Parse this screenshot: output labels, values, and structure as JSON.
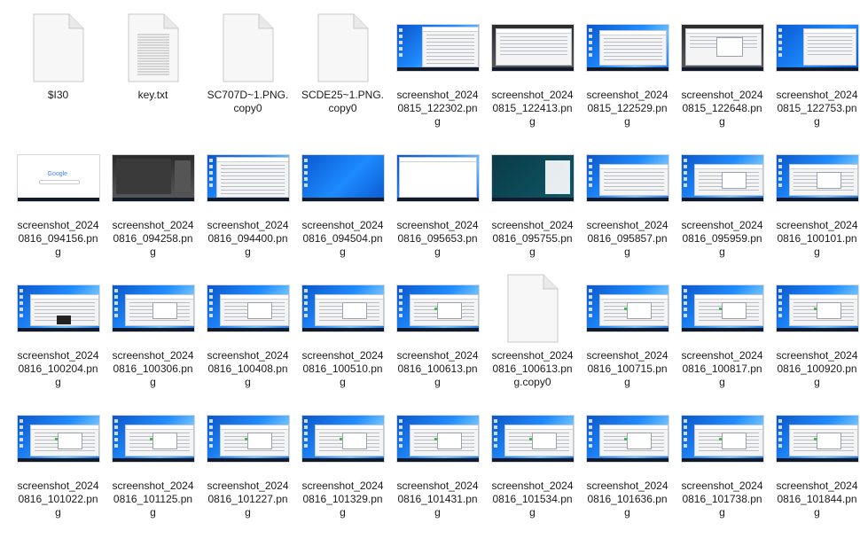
{
  "items": [
    {
      "name": "$I30",
      "type": "blank",
      "label_lines": [
        "$I30"
      ]
    },
    {
      "name": "key.txt",
      "type": "text",
      "label_lines": [
        "key.txt"
      ]
    },
    {
      "name": "SC707D~1.PNG.copy0",
      "type": "blank",
      "label_lines": [
        "SC707D~1.PNG.",
        "copy0"
      ]
    },
    {
      "name": "SCDE25~1.PNG.copy0",
      "type": "blank",
      "label_lines": [
        "SCDE25~1.PNG.",
        "copy0"
      ]
    },
    {
      "name": "screenshot_20240815_122302.png",
      "type": "thumb",
      "variant": "list",
      "label_lines": [
        "screenshot_2024",
        "0815_122302.pn",
        "g"
      ]
    },
    {
      "name": "screenshot_20240815_122413.png",
      "type": "thumb",
      "variant": "dark",
      "label_lines": [
        "screenshot_2024",
        "0815_122413.pn",
        "g"
      ]
    },
    {
      "name": "screenshot_20240815_122529.png",
      "type": "thumb",
      "variant": "window",
      "label_lines": [
        "screenshot_2024",
        "0815_122529.pn",
        "g"
      ]
    },
    {
      "name": "screenshot_20240815_122648.png",
      "type": "thumb",
      "variant": "dialog-dark",
      "label_lines": [
        "screenshot_2024",
        "0815_122648.pn",
        "g"
      ]
    },
    {
      "name": "screenshot_20240815_122753.png",
      "type": "thumb",
      "variant": "blue-window",
      "label_lines": [
        "screenshot_2024",
        "0815_122753.pn",
        "g"
      ]
    },
    {
      "name": "screenshot_20240816_094156.png",
      "type": "thumb",
      "variant": "google",
      "label_lines": [
        "screenshot_2024",
        "0816_094156.pn",
        "g"
      ]
    },
    {
      "name": "screenshot_20240816_094258.png",
      "type": "thumb",
      "variant": "video",
      "label_lines": [
        "screenshot_2024",
        "0816_094258.pn",
        "g"
      ]
    },
    {
      "name": "screenshot_20240816_094400.png",
      "type": "thumb",
      "variant": "search",
      "label_lines": [
        "screenshot_2024",
        "0816_094400.pn",
        "g"
      ]
    },
    {
      "name": "screenshot_20240816_094504.png",
      "type": "thumb",
      "variant": "desktop",
      "label_lines": [
        "screenshot_2024",
        "0816_094504.pn",
        "g"
      ]
    },
    {
      "name": "screenshot_20240816_095653.png",
      "type": "thumb",
      "variant": "web",
      "label_lines": [
        "screenshot_2024",
        "0816_095653.pn",
        "g"
      ]
    },
    {
      "name": "screenshot_20240816_095755.png",
      "type": "thumb",
      "variant": "teal",
      "label_lines": [
        "screenshot_2024",
        "0816_095755.pn",
        "g"
      ]
    },
    {
      "name": "screenshot_20240816_095857.png",
      "type": "thumb",
      "variant": "explorer",
      "label_lines": [
        "screenshot_2024",
        "0816_095857.pn",
        "g"
      ]
    },
    {
      "name": "screenshot_20240816_095959.png",
      "type": "thumb",
      "variant": "explorer-dialog",
      "label_lines": [
        "screenshot_2024",
        "0816_095959.pn",
        "g"
      ]
    },
    {
      "name": "screenshot_20240816_100101.png",
      "type": "thumb",
      "variant": "explorer-dialog",
      "label_lines": [
        "screenshot_2024",
        "0816_100101.pn",
        "g"
      ]
    },
    {
      "name": "screenshot_20240816_100204.png",
      "type": "thumb",
      "variant": "explorer-dark",
      "label_lines": [
        "screenshot_2024",
        "0816_100204.pn",
        "g"
      ]
    },
    {
      "name": "screenshot_20240816_100306.png",
      "type": "thumb",
      "variant": "explorer-dialog",
      "label_lines": [
        "screenshot_2024",
        "0816_100306.pn",
        "g"
      ]
    },
    {
      "name": "screenshot_20240816_100408.png",
      "type": "thumb",
      "variant": "explorer-dialog",
      "label_lines": [
        "screenshot_2024",
        "0816_100408.pn",
        "g"
      ]
    },
    {
      "name": "screenshot_20240816_100510.png",
      "type": "thumb",
      "variant": "explorer-dialog",
      "label_lines": [
        "screenshot_2024",
        "0816_100510.pn",
        "g"
      ]
    },
    {
      "name": "screenshot_20240816_100613.png",
      "type": "thumb",
      "variant": "explorer-green",
      "label_lines": [
        "screenshot_2024",
        "0816_100613.pn",
        "g"
      ]
    },
    {
      "name": "screenshot_20240816_100613.png.copy0",
      "type": "blank",
      "label_lines": [
        "screenshot_2024",
        "0816_100613.pn",
        "g.copy0"
      ]
    },
    {
      "name": "screenshot_20240816_100715.png",
      "type": "thumb",
      "variant": "explorer-green",
      "label_lines": [
        "screenshot_2024",
        "0816_100715.pn",
        "g"
      ]
    },
    {
      "name": "screenshot_20240816_100817.png",
      "type": "thumb",
      "variant": "explorer-green",
      "label_lines": [
        "screenshot_2024",
        "0816_100817.pn",
        "g"
      ]
    },
    {
      "name": "screenshot_20240816_100920.png",
      "type": "thumb",
      "variant": "explorer-green",
      "label_lines": [
        "screenshot_2024",
        "0816_100920.pn",
        "g"
      ]
    },
    {
      "name": "screenshot_20240816_101022.png",
      "type": "thumb",
      "variant": "explorer-green",
      "label_lines": [
        "screenshot_2024",
        "0816_101022.pn",
        "g"
      ]
    },
    {
      "name": "screenshot_20240816_101125.png",
      "type": "thumb",
      "variant": "explorer-green",
      "label_lines": [
        "screenshot_2024",
        "0816_101125.pn",
        "g"
      ]
    },
    {
      "name": "screenshot_20240816_101227.png",
      "type": "thumb",
      "variant": "explorer-green",
      "label_lines": [
        "screenshot_2024",
        "0816_101227.pn",
        "g"
      ]
    },
    {
      "name": "screenshot_20240816_101329.png",
      "type": "thumb",
      "variant": "explorer-green",
      "label_lines": [
        "screenshot_2024",
        "0816_101329.pn",
        "g"
      ]
    },
    {
      "name": "screenshot_20240816_101431.png",
      "type": "thumb",
      "variant": "explorer-green",
      "label_lines": [
        "screenshot_2024",
        "0816_101431.pn",
        "g"
      ]
    },
    {
      "name": "screenshot_20240816_101534.png",
      "type": "thumb",
      "variant": "explorer-green",
      "label_lines": [
        "screenshot_2024",
        "0816_101534.pn",
        "g"
      ]
    },
    {
      "name": "screenshot_20240816_101636.png",
      "type": "thumb",
      "variant": "explorer-green",
      "label_lines": [
        "screenshot_2024",
        "0816_101636.pn",
        "g"
      ]
    },
    {
      "name": "screenshot_20240816_101738.png",
      "type": "thumb",
      "variant": "explorer-green",
      "label_lines": [
        "screenshot_2024",
        "0816_101738.pn",
        "g"
      ]
    },
    {
      "name": "screenshot_20240816_101844.png",
      "type": "thumb",
      "variant": "explorer-green",
      "label_lines": [
        "screenshot_2024",
        "0816_101844.pn",
        "g"
      ]
    }
  ],
  "colors": {
    "label_text": "#1a1a1a",
    "file_icon_fill": "#f7f7f7",
    "file_icon_border": "#c9c9c9",
    "desktop_blue": "#1f8bff",
    "progress_green": "#3fbf4b"
  }
}
